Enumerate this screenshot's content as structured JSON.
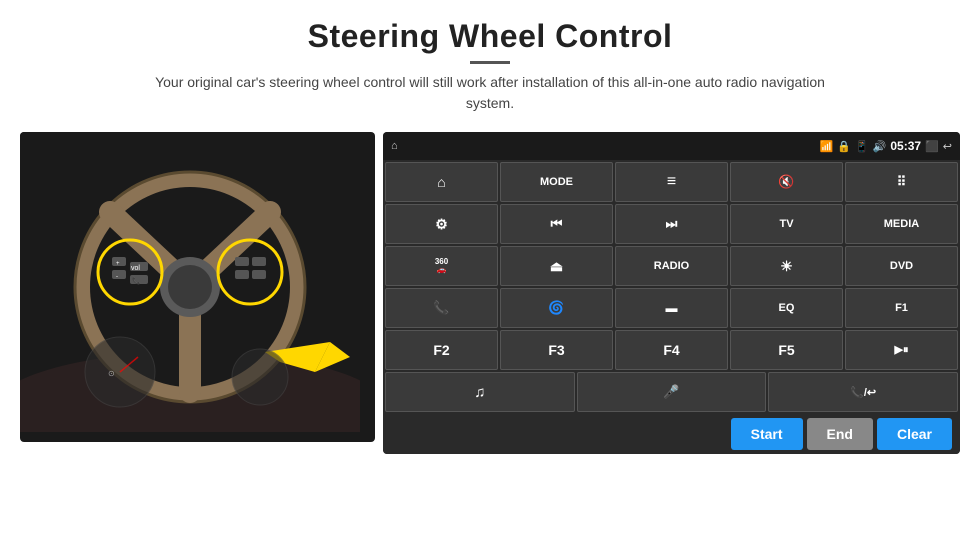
{
  "header": {
    "title": "Steering Wheel Control",
    "subtitle": "Your original car's steering wheel control will still work after installation of this all-in-one auto radio navigation system."
  },
  "status_bar": {
    "time": "05:37",
    "icons": [
      "wifi",
      "lock",
      "sim",
      "bluetooth",
      "cast",
      "back"
    ]
  },
  "button_rows": [
    [
      {
        "id": "home",
        "label": "",
        "icon": "home"
      },
      {
        "id": "mode",
        "label": "MODE",
        "icon": ""
      },
      {
        "id": "list",
        "label": "",
        "icon": "list"
      },
      {
        "id": "vol-mute",
        "label": "",
        "icon": "vol-mute"
      },
      {
        "id": "apps",
        "label": "",
        "icon": "apps"
      }
    ],
    [
      {
        "id": "settings",
        "label": "",
        "icon": "settings"
      },
      {
        "id": "prev",
        "label": "",
        "icon": "prev"
      },
      {
        "id": "next",
        "label": "",
        "icon": "next"
      },
      {
        "id": "tv",
        "label": "TV",
        "icon": ""
      },
      {
        "id": "media",
        "label": "MEDIA",
        "icon": ""
      }
    ],
    [
      {
        "id": "360",
        "label": "360",
        "icon": ""
      },
      {
        "id": "eject",
        "label": "",
        "icon": "eject"
      },
      {
        "id": "radio",
        "label": "RADIO",
        "icon": ""
      },
      {
        "id": "brightness",
        "label": "",
        "icon": "brightness"
      },
      {
        "id": "dvd",
        "label": "DVD",
        "icon": ""
      }
    ],
    [
      {
        "id": "phone",
        "label": "",
        "icon": "phone"
      },
      {
        "id": "browser",
        "label": "",
        "icon": "browser"
      },
      {
        "id": "screen",
        "label": "",
        "icon": "screen"
      },
      {
        "id": "eq",
        "label": "EQ",
        "icon": ""
      },
      {
        "id": "f1",
        "label": "F1",
        "icon": ""
      }
    ],
    [
      {
        "id": "f2",
        "label": "F2",
        "icon": ""
      },
      {
        "id": "f3",
        "label": "F3",
        "icon": ""
      },
      {
        "id": "f4",
        "label": "F4",
        "icon": ""
      },
      {
        "id": "f5",
        "label": "F5",
        "icon": ""
      },
      {
        "id": "playpause",
        "label": "",
        "icon": "playpause"
      }
    ]
  ],
  "bottom_row": [
    {
      "id": "music",
      "label": "",
      "icon": "music"
    },
    {
      "id": "mic",
      "label": "",
      "icon": "mic"
    },
    {
      "id": "call",
      "label": "",
      "icon": "call"
    }
  ],
  "action_buttons": {
    "start": "Start",
    "end": "End",
    "clear": "Clear"
  }
}
